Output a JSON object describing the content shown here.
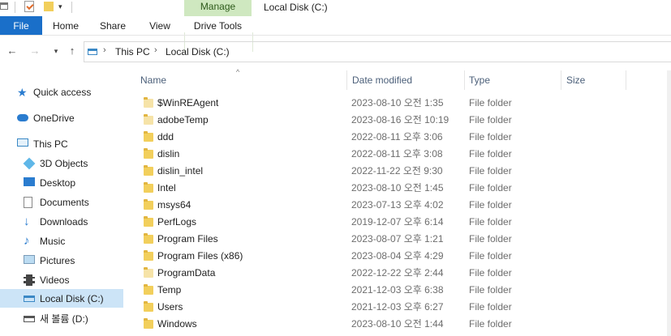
{
  "window": {
    "title": "Local Disk (C:)"
  },
  "ribbon": {
    "manage_label": "Manage",
    "tabs": [
      "File",
      "Home",
      "Share",
      "View",
      "Drive Tools"
    ]
  },
  "address": {
    "crumbs": [
      "This PC",
      "Local Disk (C:)"
    ]
  },
  "sidebar": {
    "items": [
      {
        "label": "Quick access",
        "icon": "star-icon"
      },
      {
        "label": "OneDrive",
        "icon": "cloud-icon"
      },
      {
        "label": "This PC",
        "icon": "computer-icon"
      },
      {
        "label": "3D Objects",
        "icon": "cube-icon"
      },
      {
        "label": "Desktop",
        "icon": "desktop-icon"
      },
      {
        "label": "Documents",
        "icon": "documents-icon"
      },
      {
        "label": "Downloads",
        "icon": "download-arrow-icon"
      },
      {
        "label": "Music",
        "icon": "music-note-icon"
      },
      {
        "label": "Pictures",
        "icon": "pictures-icon"
      },
      {
        "label": "Videos",
        "icon": "film-icon"
      },
      {
        "label": "Local Disk (C:)",
        "icon": "drive-icon"
      },
      {
        "label": "새 볼륨 (D:)",
        "icon": "drive-icon"
      }
    ],
    "selected": "Local Disk (C:)"
  },
  "table": {
    "columns": [
      "Name",
      "Date modified",
      "Type",
      "Size"
    ],
    "rows": [
      {
        "name": "$WinREAgent",
        "date": "2023-08-10 오전 1:35",
        "type": "File folder",
        "faded": true
      },
      {
        "name": "adobeTemp",
        "date": "2023-08-16 오전 10:19",
        "type": "File folder",
        "faded": true
      },
      {
        "name": "ddd",
        "date": "2022-08-11 오후 3:06",
        "type": "File folder",
        "faded": false
      },
      {
        "name": "dislin",
        "date": "2022-08-11 오후 3:08",
        "type": "File folder",
        "faded": false
      },
      {
        "name": "dislin_intel",
        "date": "2022-11-22 오전 9:30",
        "type": "File folder",
        "faded": false
      },
      {
        "name": "Intel",
        "date": "2023-08-10 오전 1:45",
        "type": "File folder",
        "faded": false
      },
      {
        "name": "msys64",
        "date": "2023-07-13 오후 4:02",
        "type": "File folder",
        "faded": false
      },
      {
        "name": "PerfLogs",
        "date": "2019-12-07 오후 6:14",
        "type": "File folder",
        "faded": false
      },
      {
        "name": "Program Files",
        "date": "2023-08-07 오후 1:21",
        "type": "File folder",
        "faded": false
      },
      {
        "name": "Program Files (x86)",
        "date": "2023-08-04 오후 4:29",
        "type": "File folder",
        "faded": false
      },
      {
        "name": "ProgramData",
        "date": "2022-12-22 오후 2:44",
        "type": "File folder",
        "faded": true
      },
      {
        "name": "Temp",
        "date": "2021-12-03 오후 6:38",
        "type": "File folder",
        "faded": false
      },
      {
        "name": "Users",
        "date": "2021-12-03 오후 6:27",
        "type": "File folder",
        "faded": false
      },
      {
        "name": "Windows",
        "date": "2023-08-10 오전 1:44",
        "type": "File folder",
        "faded": false
      }
    ]
  },
  "colors": {
    "accent": "#1a6fc9",
    "manage_bg": "#cfe8c0",
    "selected_bg": "#cce4f7",
    "folder": "#f2cf5c"
  }
}
